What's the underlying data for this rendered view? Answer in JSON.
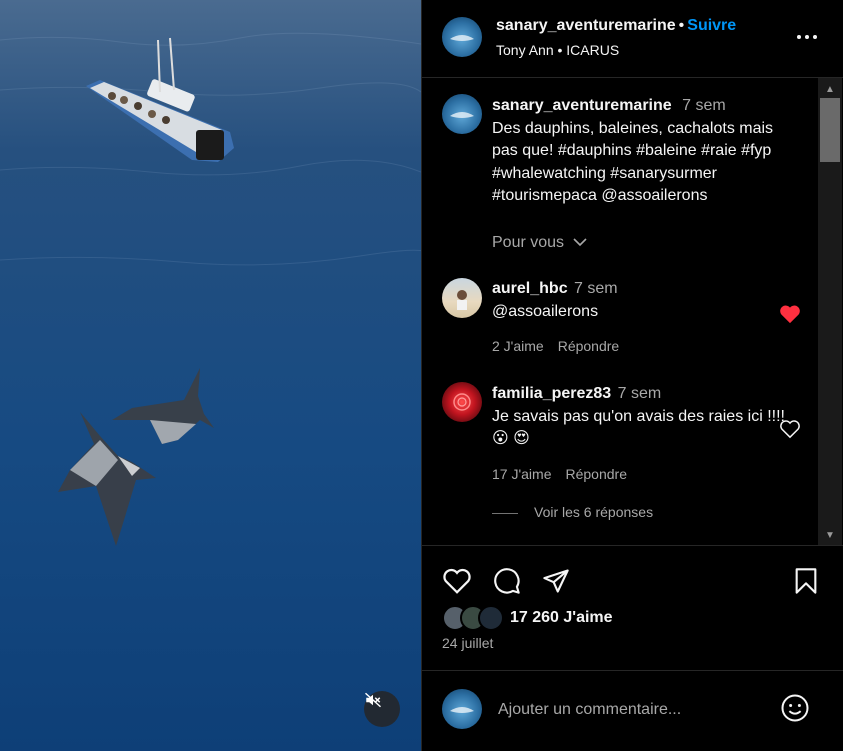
{
  "post": {
    "username": "sanary_aventuremarine",
    "follow_label": "Suivre",
    "separator": "•",
    "audio_artist": "Tony Ann",
    "audio_track": "ICARUS",
    "caption_username": "sanary_aventuremarine",
    "caption_time": "7 sem",
    "caption": "Des dauphins, baleines, cachalots mais pas que! #dauphins #baleine #raie #fyp #whalewatching #sanarysurmer #tourismepaca @assoailerons",
    "for_you_label": "Pour vous"
  },
  "comments": [
    {
      "username": "aurel_hbc",
      "time": "7 sem",
      "text": "@assoailerons",
      "likes": "2 J'aime",
      "reply": "Répondre",
      "liked": true
    },
    {
      "username": "familia_perez83",
      "time": "7 sem",
      "text": "Je savais pas qu'on avais des raies ici !!!! 😮 😍",
      "likes": "17 J'aime",
      "reply": "Répondre",
      "liked": false
    }
  ],
  "view_replies": "Voir les 6 réponses",
  "likes_count": "17 260 J'aime",
  "date": "24 juillet",
  "add_comment_placeholder": "Ajouter un commentaire...",
  "icons": {
    "more": "more-options-icon",
    "like": "heart-icon",
    "comment": "comment-icon",
    "share": "send-icon",
    "save": "bookmark-icon",
    "mute": "speaker-muted-icon",
    "emoji": "emoji-icon"
  },
  "colors": {
    "accent": "#0095f6",
    "liked_heart": "#ff3040",
    "background": "#000000"
  }
}
